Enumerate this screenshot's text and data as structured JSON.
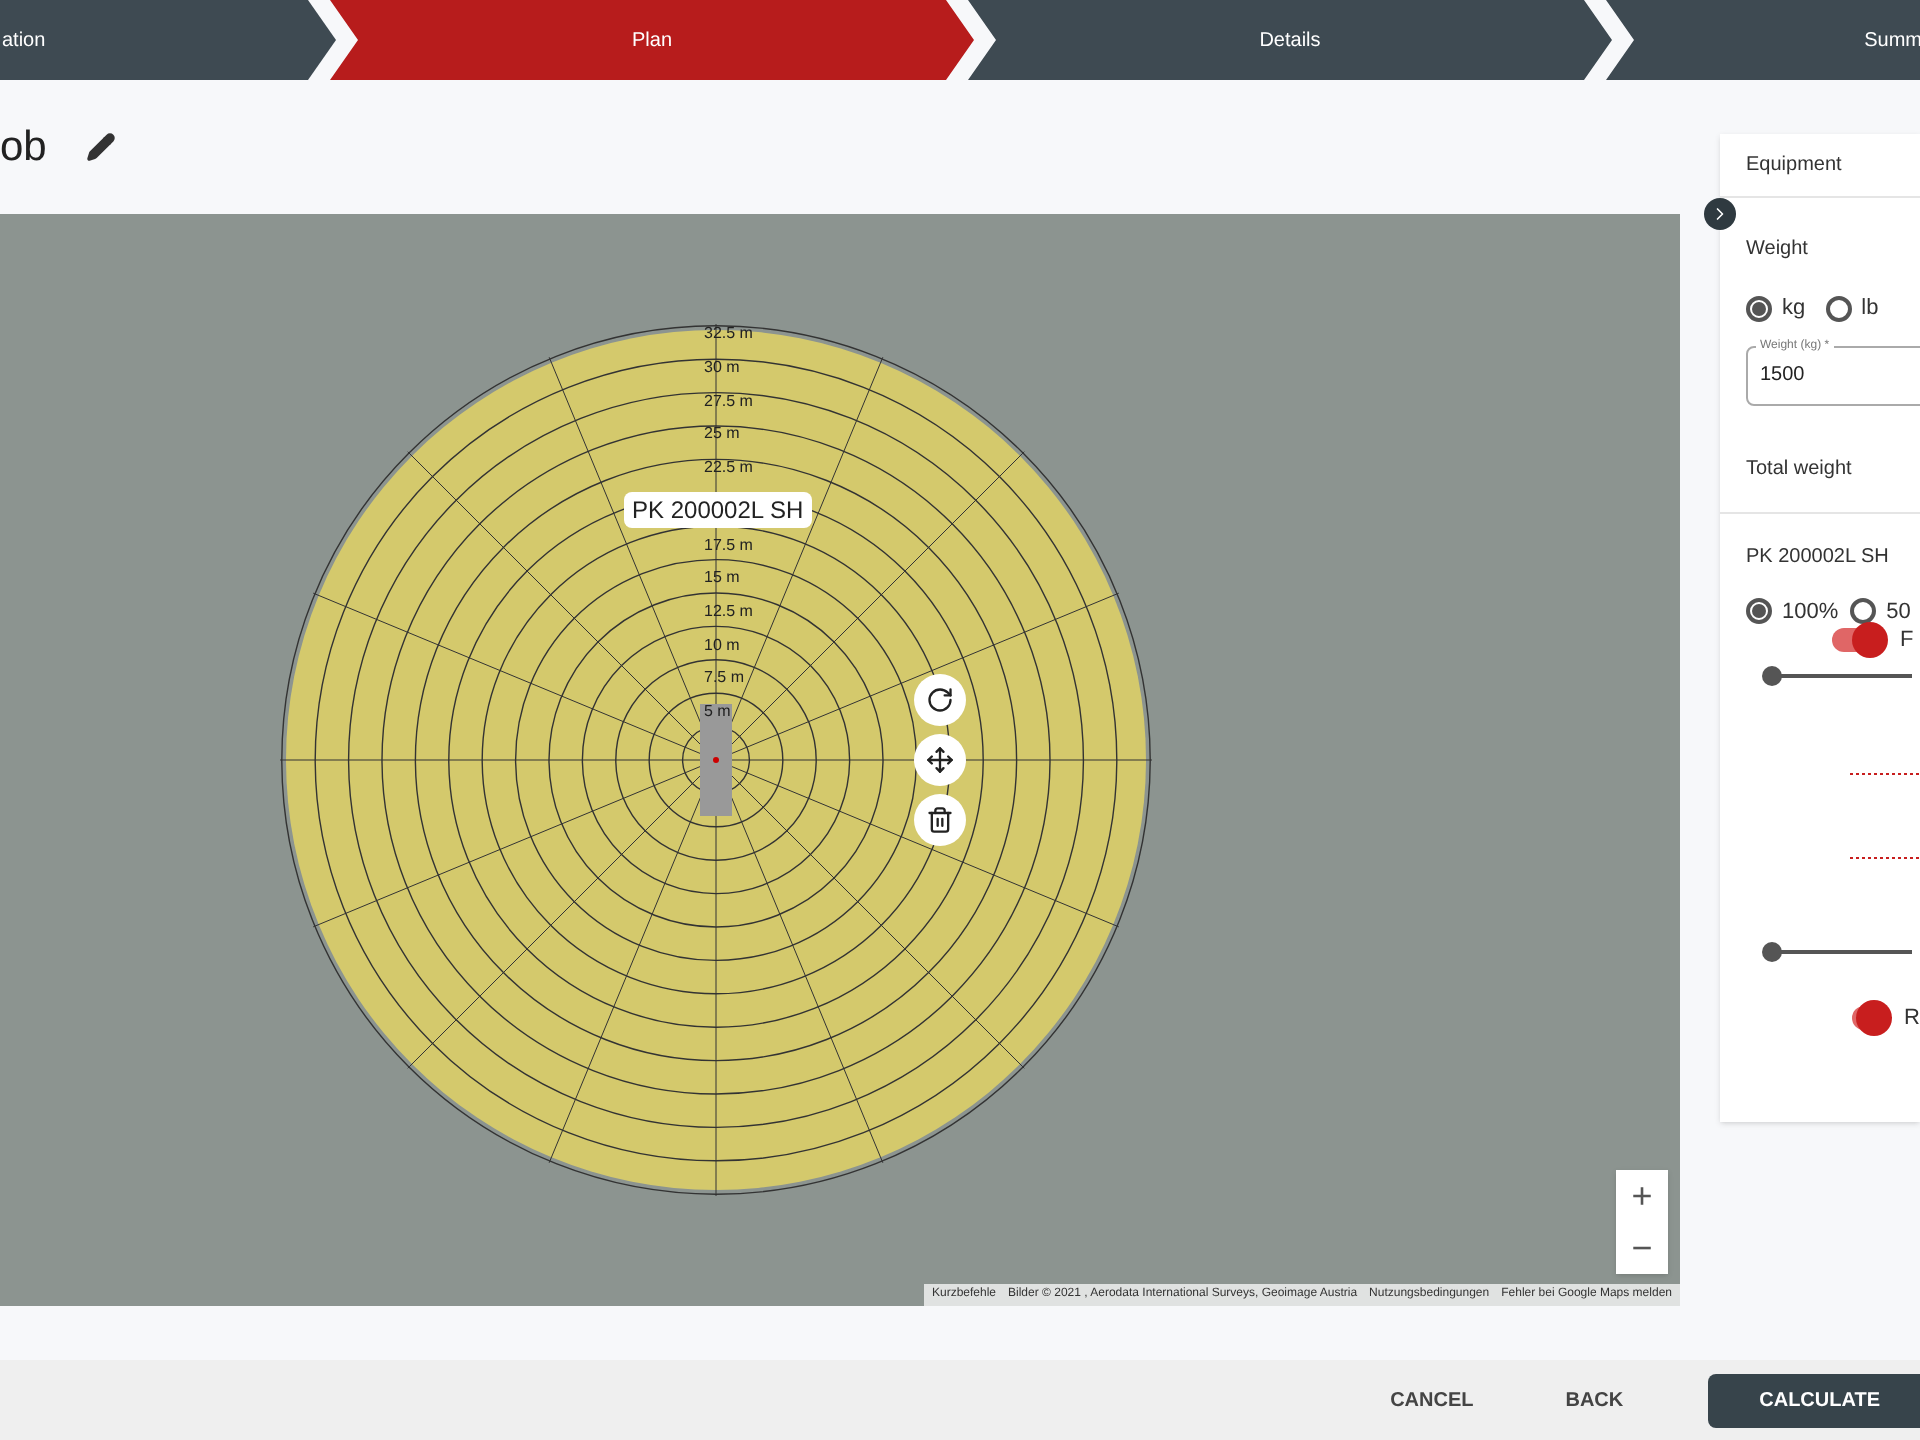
{
  "steps": [
    {
      "label": "ation",
      "selected": false
    },
    {
      "label": "Plan",
      "selected": true
    },
    {
      "label": "Details",
      "selected": false
    },
    {
      "label": "Summ",
      "selected": false
    }
  ],
  "job": {
    "title": "ob"
  },
  "map": {
    "crane_label": "PK 200002L SH",
    "outer_ring_labels": [
      "32.5 m",
      "30 m",
      "27.5 m",
      "25 m",
      "22.5 m"
    ],
    "inner_ring_labels": [
      "17.5 m",
      "15 m",
      "12.5 m",
      "10 m",
      "7.5 m",
      "5 m"
    ],
    "attribution": [
      "Kurzbefehle",
      "Bilder © 2021 , Aerodata International Surveys, Geoimage Austria",
      "Nutzungsbedingungen",
      "Fehler bei Google Maps melden"
    ],
    "zoom_in": "+",
    "zoom_out": "−"
  },
  "panel": {
    "tab": "Equipment",
    "weight_title": "Weight",
    "units": [
      {
        "label": "kg",
        "selected": true
      },
      {
        "label": "lb",
        "selected": false
      }
    ],
    "weight_field": {
      "label": "Weight (kg) *",
      "value": "1500"
    },
    "total_weight": "Total weight",
    "crane": "PK 200002L SH",
    "loads": [
      {
        "label": "100%",
        "selected": true
      },
      {
        "label": "50",
        "selected": false
      }
    ],
    "switches": [
      {
        "label": "F",
        "on": true
      },
      {
        "label": "R",
        "on": true
      }
    ],
    "sliders": [
      {
        "level": 0
      },
      {
        "level": 0
      }
    ]
  },
  "footer": {
    "buttons": [
      {
        "label": "CANCEL",
        "kind": "text"
      },
      {
        "label": "BACK",
        "kind": "text"
      },
      {
        "label": "CALCULATE",
        "kind": "primary"
      }
    ]
  }
}
